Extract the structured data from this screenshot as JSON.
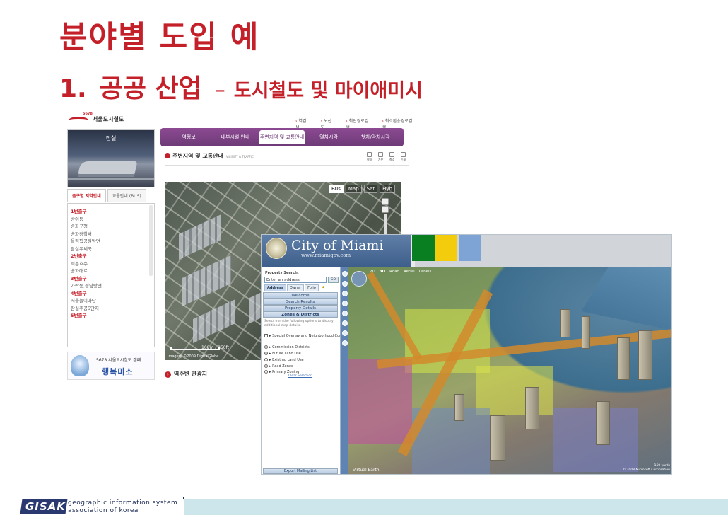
{
  "slide": {
    "title": "분야별 도입 예",
    "subtitle_num": "1.",
    "subtitle_main": "공공 산업",
    "subtitle_dash": "–",
    "subtitle_sub": "도시철도 및 마이애미시"
  },
  "metro": {
    "logo_badge": "5678",
    "logo_name": "서울도시철도",
    "top_links": [
      "역검색",
      "노선도",
      "최단경로검색",
      "최소환승경로검색"
    ],
    "station_label": "잠실",
    "nav": [
      "역정보",
      "내부시설 안내",
      "주변지역 및 교통안내",
      "열차시각",
      "첫차/막차시각"
    ],
    "nav_active": 2,
    "section_title": "주변지역 및 교통안내",
    "section_title_en": "VICINITY & TRAFFIC",
    "tools": [
      "확대",
      "기본",
      "축소",
      "인쇄"
    ],
    "subtabs": [
      "출구별 지역안내",
      "교통안내 (BUS)"
    ],
    "exit_list": [
      {
        "text": "1번출구",
        "head": true
      },
      {
        "text": "방이동",
        "head": false
      },
      {
        "text": "송파구청",
        "head": false
      },
      {
        "text": "송파경찰서",
        "head": false
      },
      {
        "text": "올림픽공원방면",
        "head": false
      },
      {
        "text": "잠실우체국",
        "head": false
      },
      {
        "text": "2번출구",
        "head": true
      },
      {
        "text": "석촌호수",
        "head": false
      },
      {
        "text": "송파대로",
        "head": false
      },
      {
        "text": "3번출구",
        "head": true
      },
      {
        "text": "가락동,성남방면",
        "head": false
      },
      {
        "text": "4번출구",
        "head": true
      },
      {
        "text": "서울놀이마당",
        "head": false
      },
      {
        "text": "잠실주공5단지",
        "head": false
      },
      {
        "text": "5번출구",
        "head": true
      }
    ],
    "map_types": [
      "Bus",
      "Map",
      "Sat",
      "Hyb"
    ],
    "map_type_active": 0,
    "scale_m": "100m",
    "scale_ft": "250ft",
    "copyright": "Imagery ©2009 DigitalGlobe",
    "banner_line1": "5678 서울도시철도 캠페",
    "banner_line2": "행복미소",
    "bottom_link": "역주변 관광지"
  },
  "miami": {
    "city_name": "City of Miami",
    "url": "www.miamigov.com",
    "brand_colors": [
      "#0a7f21",
      "#f3cc0d",
      "#7ea4d6"
    ],
    "search_label": "Property Search:",
    "search_placeholder": "Enter an address",
    "go_label": "GO",
    "search_tabs": [
      "Address",
      "Owner",
      "Folio"
    ],
    "sections": [
      "Welcome",
      "Search Results",
      "Property Details",
      "Zones & Districts"
    ],
    "description": "Select from the following options to display additional map details.",
    "options": [
      {
        "label": "Special Overlay and Neighborhood Conservation Districts",
        "kind": "check"
      },
      {
        "label": "Commission Districts",
        "kind": "radio"
      },
      {
        "label": "Future Land Use",
        "kind": "radio"
      },
      {
        "label": "Existing Land Use",
        "kind": "radio"
      },
      {
        "label": "Road Zones",
        "kind": "radio"
      },
      {
        "label": "Primary Zoning",
        "kind": "radio"
      }
    ],
    "clear_selection": "Clear Selection",
    "export_label": "Export Mailing List",
    "map_toolbar": [
      "2D",
      "3D",
      "Road",
      "Aerial",
      "Labels"
    ],
    "map_toolbar_active": 1,
    "virtual_earth": "Virtual Earth",
    "scale_text": "150 yards",
    "map_copyright": "© 2008 Microsoft Corporation"
  },
  "footer": {
    "logo": "GISAK",
    "org_line1": "geographic information system",
    "org_line2": "association of korea"
  }
}
